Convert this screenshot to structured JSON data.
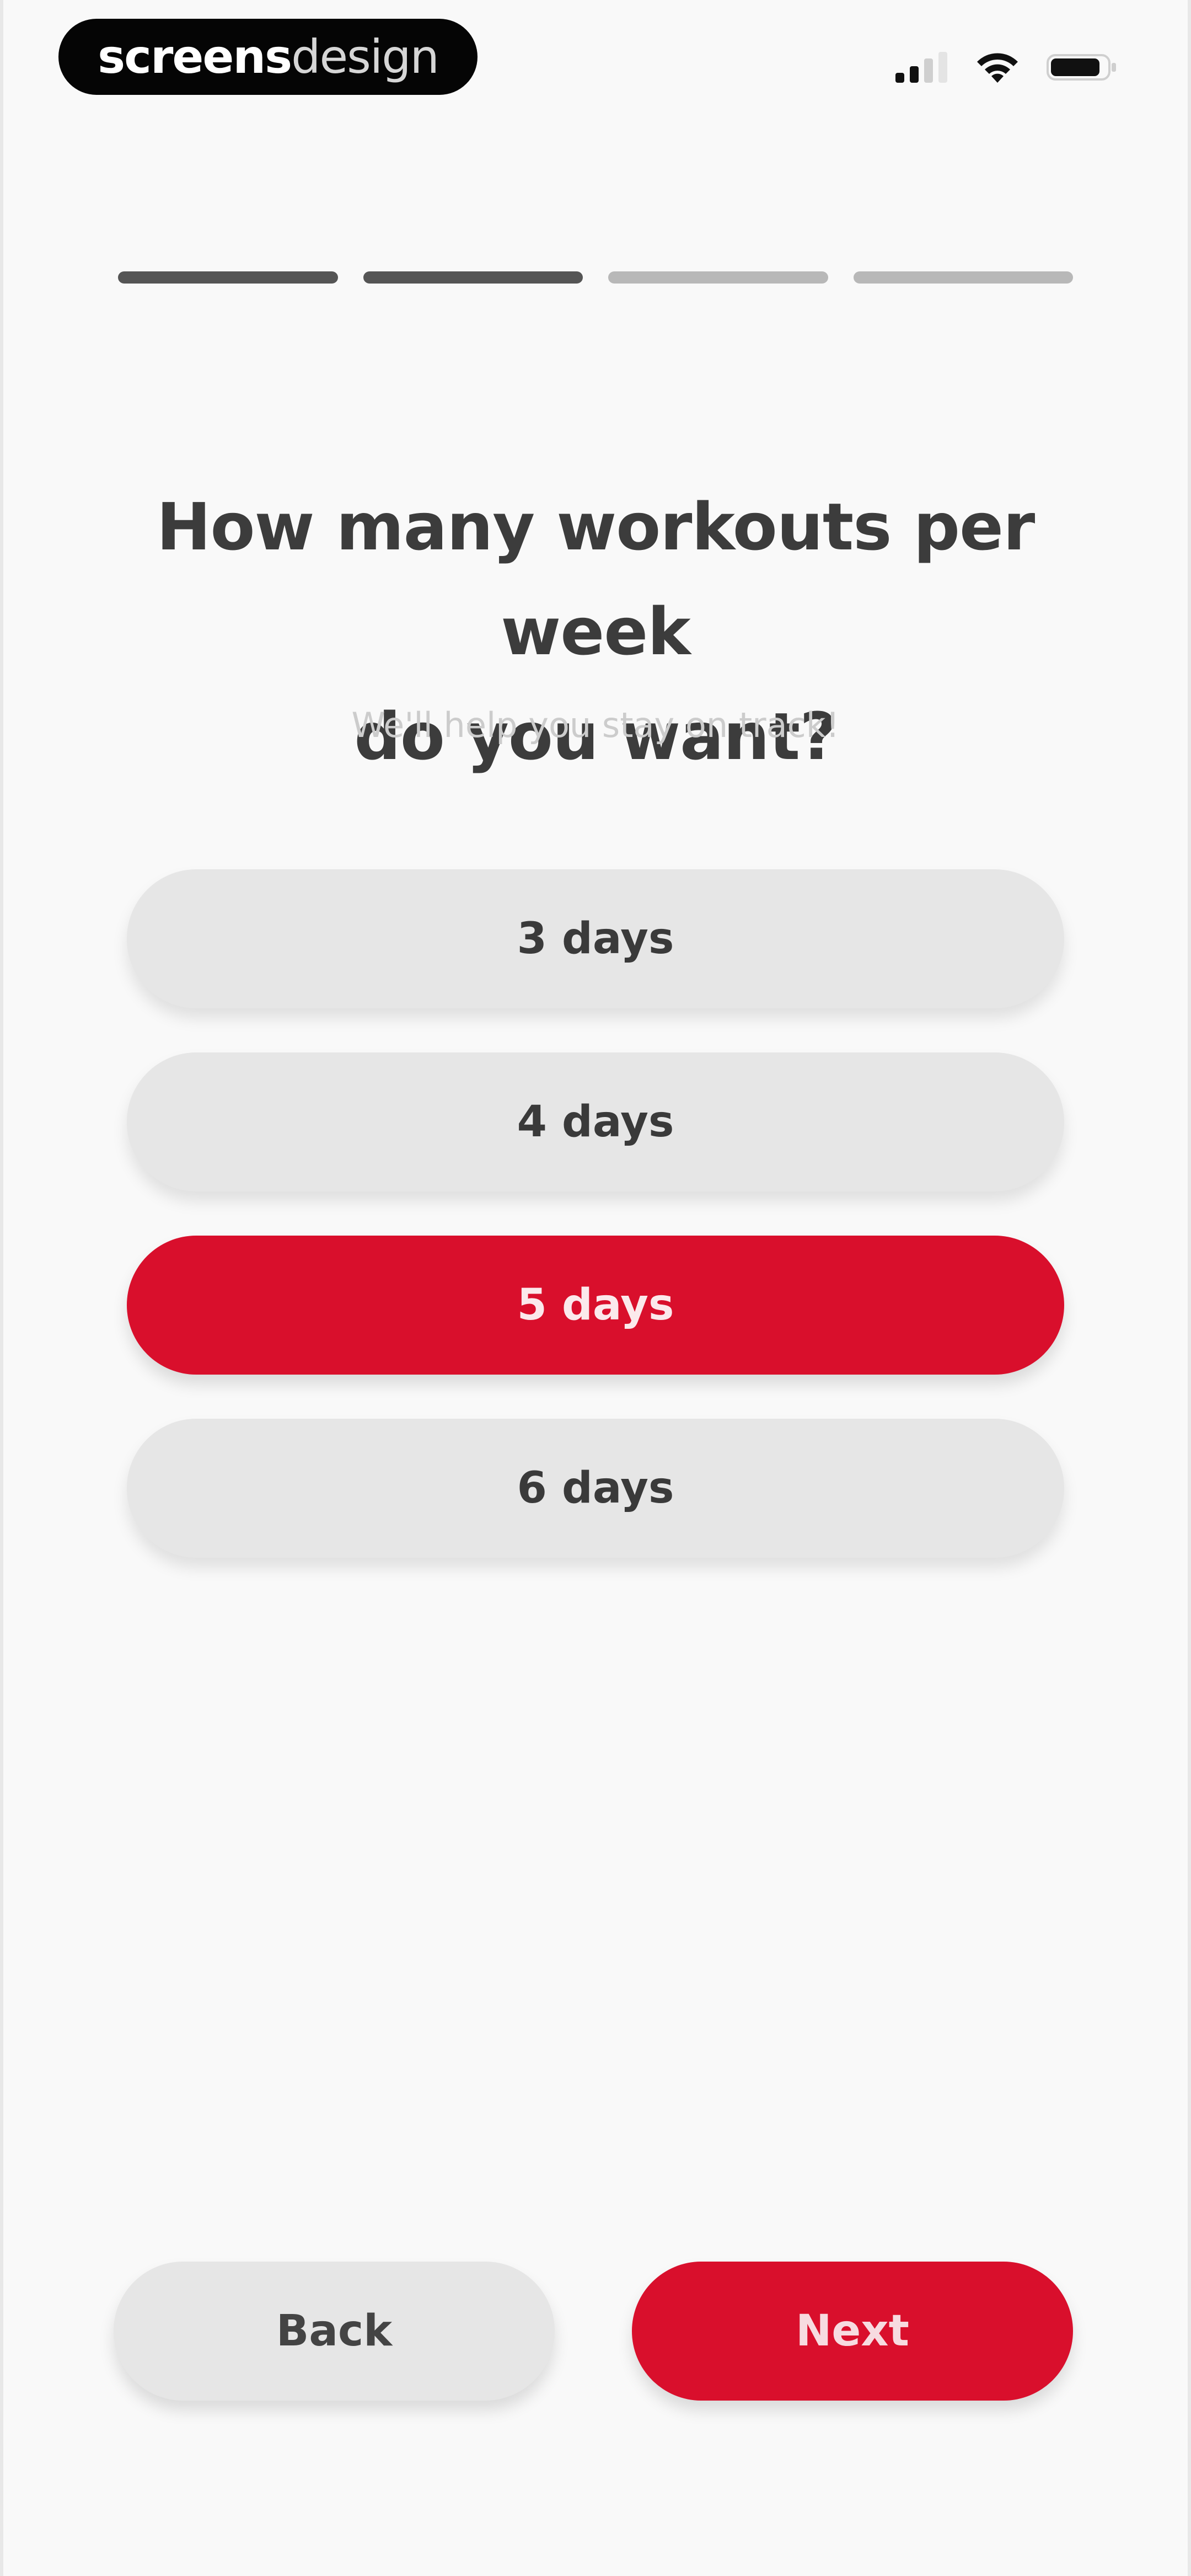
{
  "status_bar": {
    "brand_bold": "screens",
    "brand_light": "design",
    "icons": [
      "signal-icon",
      "wifi-icon",
      "battery-icon"
    ]
  },
  "progress": {
    "total_steps": 4,
    "completed_steps": 2
  },
  "question": {
    "title_line1": "How many workouts per week",
    "title_line2": "do you want?",
    "subtitle": "We'll help you stay on track!"
  },
  "options": [
    {
      "label": "3 days",
      "selected": false
    },
    {
      "label": "4 days",
      "selected": false
    },
    {
      "label": "5 days",
      "selected": true
    },
    {
      "label": "6 days",
      "selected": false
    }
  ],
  "footer": {
    "back_label": "Back",
    "next_label": "Next"
  },
  "colors": {
    "accent": "#d90f2c",
    "option_bg": "#e6e6e6",
    "page_bg": "#f9f9f9",
    "progress_done": "#555555",
    "progress_todo": "#b8b8b8"
  }
}
